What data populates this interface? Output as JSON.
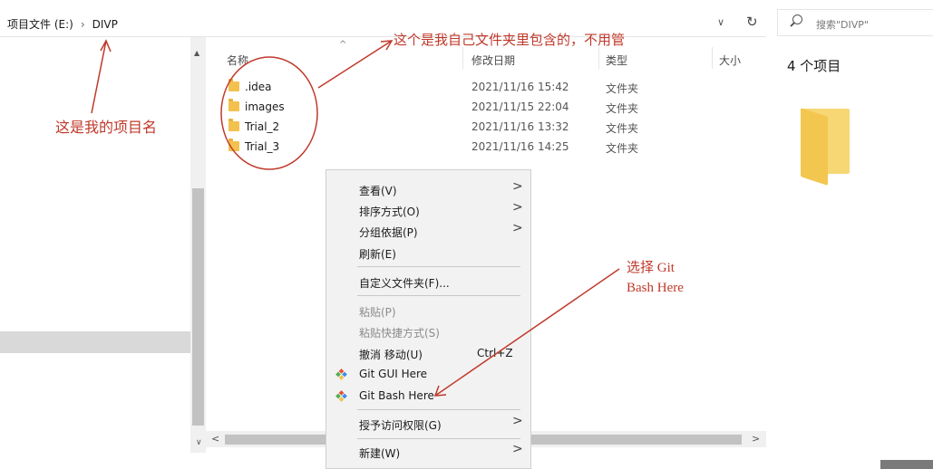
{
  "address_bar": {
    "breadcrumbs": [
      "项目文件 (E:)",
      "DIVP"
    ],
    "separator": "›",
    "dropdown_glyph": "∨",
    "refresh_glyph": "↻"
  },
  "search": {
    "placeholder": "搜索\"DIVP\""
  },
  "columns": {
    "name": "名称",
    "date": "修改日期",
    "type": "类型",
    "size": "大小"
  },
  "files": [
    {
      "name": ".idea",
      "date": "2021/11/16 15:42",
      "type": "文件夹"
    },
    {
      "name": "images",
      "date": "2021/11/15 22:04",
      "type": "文件夹"
    },
    {
      "name": "Trial_2",
      "date": "2021/11/16 13:32",
      "type": "文件夹"
    },
    {
      "name": "Trial_3",
      "date": "2021/11/16 14:25",
      "type": "文件夹"
    }
  ],
  "details": {
    "count": "4 个项目"
  },
  "context_menu": {
    "view": "查看(V)",
    "sort": "排序方式(O)",
    "group": "分组依据(P)",
    "refresh": "刷新(E)",
    "customize": "自定义文件夹(F)...",
    "paste": "粘贴(P)",
    "paste_shortcut": "粘贴快捷方式(S)",
    "undo": "撤消 移动(U)",
    "undo_shortcut": "Ctrl+Z",
    "git_gui": "Git GUI Here",
    "git_bash": "Git Bash Here",
    "give_access": "授予访问权限(G)",
    "new": "新建(W)",
    "submenu_glyph": ">"
  },
  "annotations": {
    "project_name": "这是我的项目名",
    "own_files": "这个是我自己文件夹里包含的，不用管",
    "choose_line1": "选择  Git",
    "choose_line2": "Bash Here"
  },
  "colors": {
    "annotation_red": "#c0392b",
    "folder_yellow": "#f2c14e",
    "menu_bg": "#f2f2f2",
    "git_red": "#e84e31",
    "git_blue": "#3a8ee6",
    "git_green": "#4caf50",
    "git_yellow": "#f2c14e"
  },
  "icons": [
    "search-icon",
    "folder-icon",
    "git-icon",
    "refresh-icon",
    "chevron-down-icon",
    "chevron-right-icon"
  ]
}
